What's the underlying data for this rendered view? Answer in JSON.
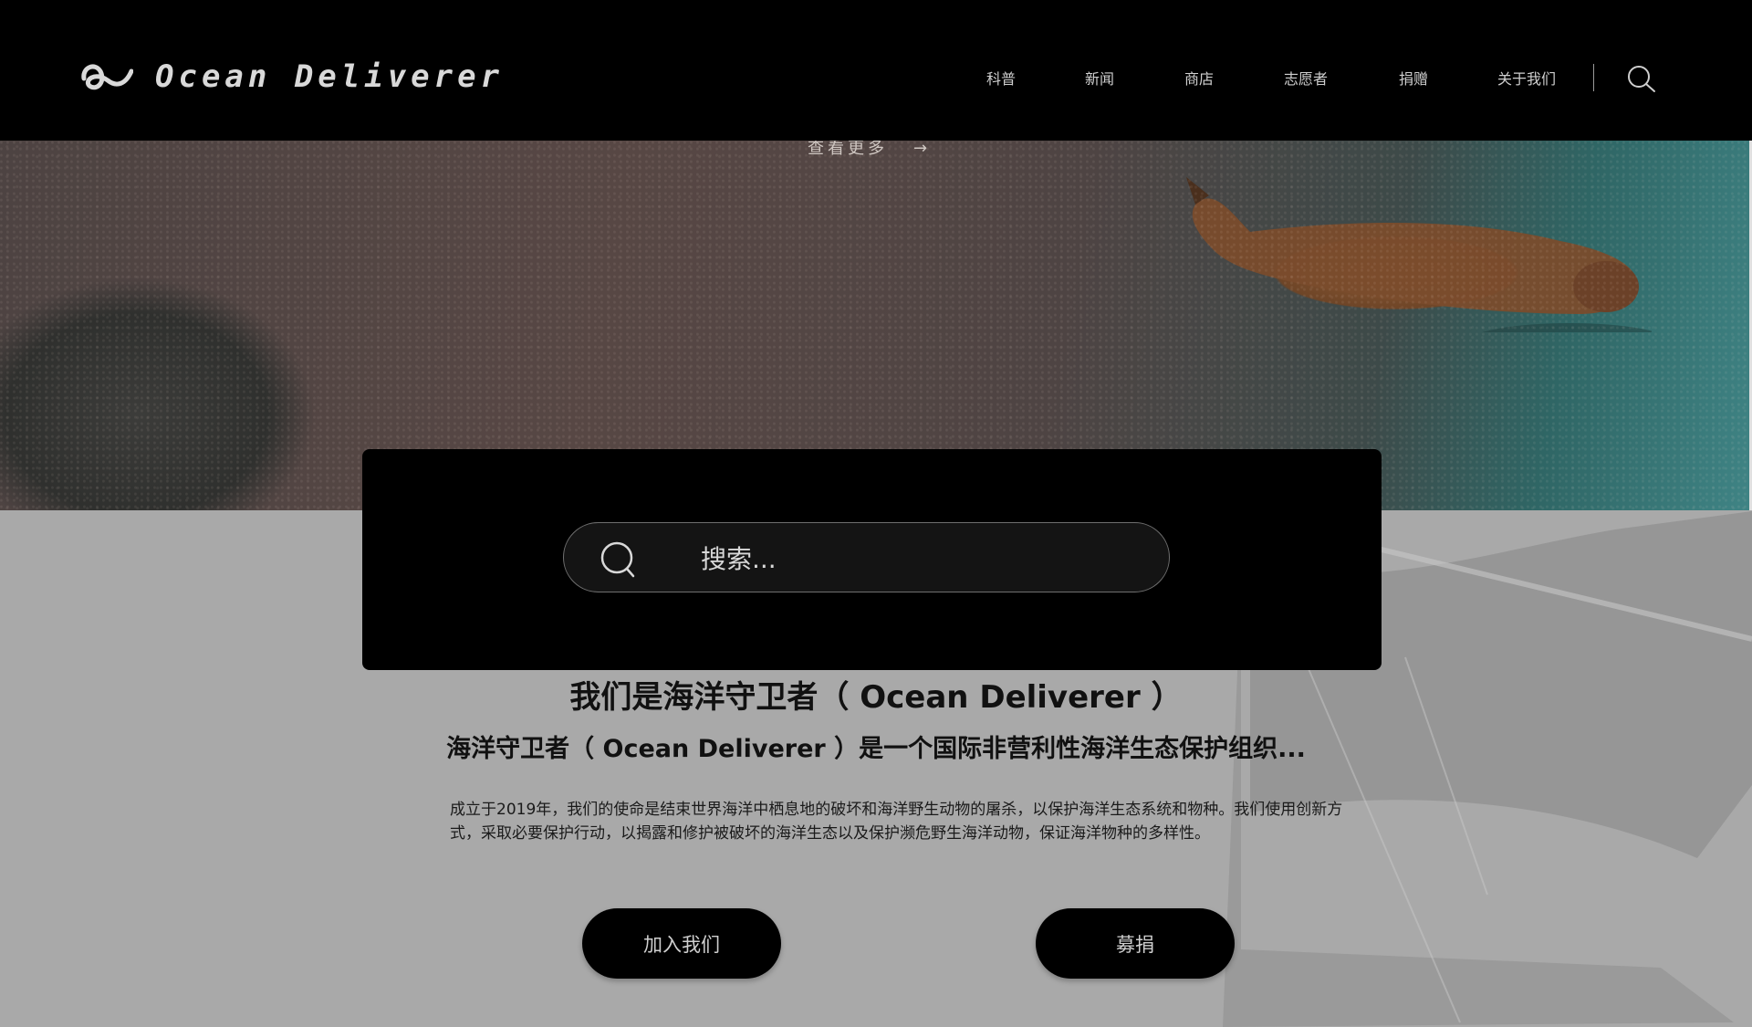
{
  "header": {
    "brand": "Ocean Deliverer",
    "nav": [
      {
        "label": "科普"
      },
      {
        "label": "新闻"
      },
      {
        "label": "商店"
      },
      {
        "label": "志愿者"
      },
      {
        "label": "捐赠"
      },
      {
        "label": "关于我们"
      }
    ]
  },
  "hero": {
    "more_label": "查看更多",
    "arrow": "→"
  },
  "search": {
    "placeholder": "搜索..."
  },
  "intro": {
    "title": "我们是海洋守卫者（ Ocean   Deliverer ）",
    "subtitle": "海洋守卫者（ Ocean   Deliverer ）是一个国际非营利性海洋生态保护组织...",
    "description": "成立于2019年，我们的使命是结束世界海洋中栖息地的破坏和海洋野生动物的屠杀，以保护海洋生态系统和物种。我们使用创新方式，采取必要保护行动，以揭露和修护被破坏的海洋生态以及保护濒危野生海洋动物，保证海洋物种的多样性。"
  },
  "actions": {
    "join_label": "加入我们",
    "donate_label": "募捐"
  },
  "colors": {
    "header_bg": "#000000",
    "page_bg": "#a9a9a9",
    "button_bg": "#000000"
  },
  "icons": [
    "logo-icon",
    "search-icon",
    "arrow-right-icon"
  ]
}
